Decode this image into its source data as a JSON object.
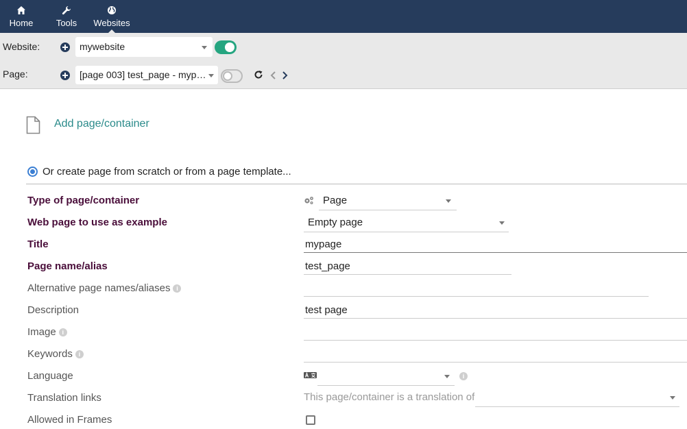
{
  "nav": {
    "items": [
      {
        "label": "Home",
        "icon": "home-icon"
      },
      {
        "label": "Tools",
        "icon": "wrench-icon"
      },
      {
        "label": "Websites",
        "icon": "globe-icon"
      }
    ],
    "active": "Websites"
  },
  "website_bar": {
    "label": "Website:",
    "selected": "mywebsite",
    "toggle_on": true
  },
  "page_bar": {
    "label": "Page:",
    "selected": "[page 003] test_page - myp…",
    "toggle_on": false
  },
  "main": {
    "add_title": "Add page/container",
    "radio_label": "Or create page from scratch or from a page template...",
    "fields": {
      "type": {
        "label": "Type of page/container",
        "value": "Page"
      },
      "example": {
        "label": "Web page to use as example",
        "value": "Empty page"
      },
      "title": {
        "label": "Title",
        "value": "mypage"
      },
      "alias": {
        "label": "Page name/alias",
        "value": "test_page"
      },
      "alt_aliases": {
        "label": "Alternative page names/aliases",
        "value": ""
      },
      "description": {
        "label": "Description",
        "value": "test page"
      },
      "image": {
        "label": "Image",
        "value": ""
      },
      "keywords": {
        "label": "Keywords",
        "value": ""
      },
      "language": {
        "label": "Language",
        "value": ""
      },
      "translation": {
        "label": "Translation links",
        "text": "This page/container is a translation of",
        "value": ""
      },
      "frames": {
        "label": "Allowed in Frames",
        "checked": false
      }
    }
  },
  "colors": {
    "nav_bg": "#263c5c",
    "accent": "#2a8a8a",
    "toggle_on": "#25a580",
    "required_label": "#4a0e3a"
  }
}
